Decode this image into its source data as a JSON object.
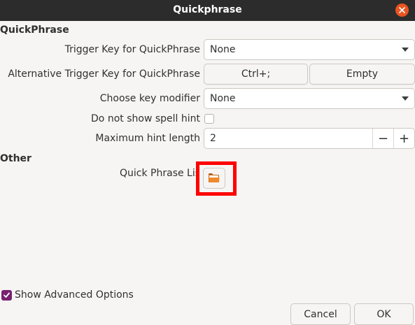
{
  "window": {
    "title": "Quickphrase"
  },
  "sections": {
    "quickphrase": "QuickPhrase",
    "other": "Other"
  },
  "fields": {
    "trigger_key": {
      "label": "Trigger Key for QuickPhrase",
      "value": "None"
    },
    "alt_trigger_key": {
      "label": "Alternative Trigger Key for QuickPhrase",
      "key1": "Ctrl+;",
      "key2": "Empty"
    },
    "key_modifier": {
      "label": "Choose key modifier",
      "value": "None"
    },
    "spell_hint": {
      "label": "Do not show spell hint",
      "checked": false
    },
    "max_hint_length": {
      "label": "Maximum hint length",
      "value": "2",
      "minus": "−",
      "plus": "+"
    },
    "quick_phrase_list": {
      "label": "Quick Phrase List"
    }
  },
  "footer": {
    "show_advanced": "Show Advanced Options",
    "show_advanced_checked": true,
    "cancel": "Cancel",
    "ok": "OK"
  },
  "colors": {
    "titlebar": "#2c2c2c",
    "close": "#e95420",
    "checkbox_checked": "#77216f",
    "highlight": "#ff0000"
  }
}
